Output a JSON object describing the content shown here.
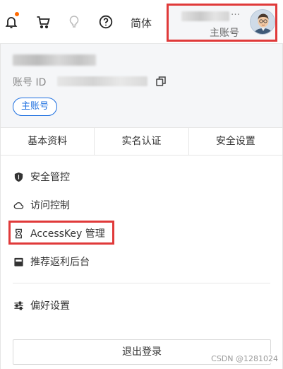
{
  "topbar": {
    "icons": {
      "bell": "bell-icon",
      "cart": "cart-icon",
      "bulb": "lightbulb-icon",
      "help": "help-icon"
    },
    "language_label": "简体",
    "account": {
      "name_suffix": "…",
      "type_label": "主账号"
    }
  },
  "panel": {
    "account_id_label": "账号 ID",
    "main_account_badge": "主账号",
    "tabs": [
      {
        "label": "基本资料"
      },
      {
        "label": "实名认证"
      },
      {
        "label": "安全设置"
      }
    ],
    "menu": [
      {
        "label": "安全管控",
        "icon": "shield-icon"
      },
      {
        "label": "访问控制",
        "icon": "cloud-icon"
      },
      {
        "label": "AccessKey 管理",
        "icon": "key-icon"
      },
      {
        "label": "推荐返利后台",
        "icon": "calendar-icon"
      }
    ],
    "preferences": {
      "label": "偏好设置",
      "icon": "sliders-icon"
    },
    "logout_label": "退出登录"
  },
  "watermark": "CSDN @1281024",
  "colors": {
    "highlight_border": "#e03a3a",
    "accent_blue": "#1d6fe0",
    "notification_dot": "#ff6a00"
  }
}
